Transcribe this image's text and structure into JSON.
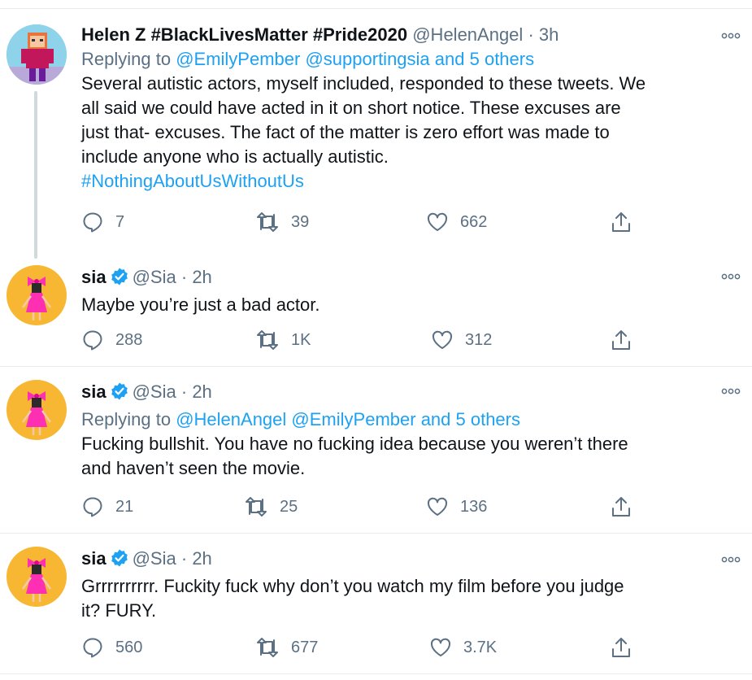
{
  "colors": {
    "link": "#1da1f2",
    "muted": "#5b7083",
    "verified": "#1da1f2",
    "sia_avatar_bg": "#f7b733",
    "helen_avatar_bg": "#7ec8e3"
  },
  "tweets": [
    {
      "name": "Helen Z #BlackLivesMatter #Pride2020",
      "handle": "@HelenAngel",
      "time": "3h",
      "verified": false,
      "replying_prefix": "Replying to",
      "replying_to": [
        "@EmilyPember",
        "@supportingsia"
      ],
      "replying_others": "and 5 others",
      "text_lines": [
        "Several autistic actors, myself included, responded to these tweets. We",
        "all said we could have acted in it on short notice. These excuses are",
        "just that- excuses. The fact of the matter is zero effort was made to",
        "include anyone who is actually autistic."
      ],
      "hashtag": "#NothingAboutUsWithoutUs",
      "replies": "7",
      "retweets": "39",
      "likes": "662",
      "avatar_icon": "pixel-character-avatar"
    },
    {
      "name": "sia",
      "handle": "@Sia",
      "time": "2h",
      "verified": true,
      "text_lines": [
        "Maybe you’re just a bad actor."
      ],
      "replies": "288",
      "retweets": "1K",
      "likes": "312",
      "avatar_icon": "pink-dress-figure-avatar"
    },
    {
      "name": "sia",
      "handle": "@Sia",
      "time": "2h",
      "verified": true,
      "replying_prefix": "Replying to",
      "replying_to": [
        "@HelenAngel",
        "@EmilyPember"
      ],
      "replying_others": "and 5 others",
      "text_lines": [
        "Fucking bullshit. You have no fucking idea because you weren’t there",
        "and haven’t seen the movie."
      ],
      "replies": "21",
      "retweets": "25",
      "likes": "136",
      "avatar_icon": "pink-dress-figure-avatar"
    },
    {
      "name": "sia",
      "handle": "@Sia",
      "time": "2h",
      "verified": true,
      "text_lines": [
        "Grrrrrrrrrr. Fuckity fuck why don’t you watch my film before you judge",
        "it? FURY."
      ],
      "replies": "560",
      "retweets": "677",
      "likes": "3.7K",
      "avatar_icon": "pink-dress-figure-avatar"
    }
  ],
  "separator_dot": "·"
}
